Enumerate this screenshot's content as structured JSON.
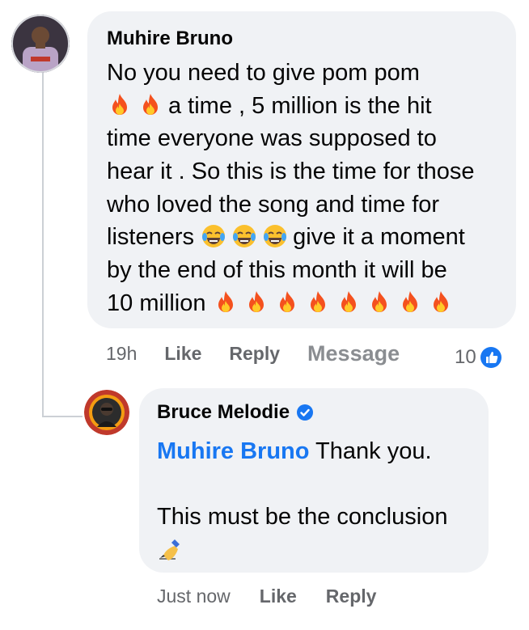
{
  "comment": {
    "author": "Muhire Bruno",
    "lines": [
      [
        "No you need to give pom pom"
      ],
      [
        "a time  , 5 million is the hit"
      ],
      [
        "time everyone was supposed to"
      ],
      [
        "hear it . So this is the time for those"
      ],
      [
        "who loved the song and time for"
      ],
      [
        "listeners",
        "give it a moment"
      ],
      [
        "by the end of this month it will be"
      ],
      [
        "10 million"
      ]
    ],
    "actions": {
      "time": "19h",
      "like": "Like",
      "reply": "Reply",
      "message": "Message"
    },
    "reactions": {
      "count": "10",
      "type": "like-icon"
    }
  },
  "reply": {
    "author": "Bruce Melodie",
    "verified": true,
    "mention": "Muhire Bruno",
    "text_line1": " Thank you.",
    "text_line3": "This must be the conclusion",
    "actions": {
      "time": "Just now",
      "like": "Like",
      "reply": "Reply"
    }
  },
  "colors": {
    "bubble": "#f0f2f5",
    "link_blue": "#1877f2",
    "meta_gray": "#65676b"
  }
}
